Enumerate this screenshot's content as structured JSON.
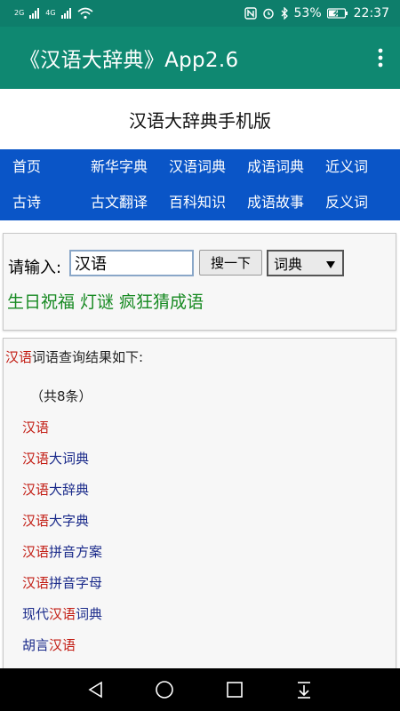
{
  "status_bar": {
    "signal_left": "2G",
    "signal_right": "4G",
    "battery": "53%",
    "time": "22:37"
  },
  "app_bar": {
    "title": "《汉语大辞典》App2.6"
  },
  "site_title": "汉语大辞典手机版",
  "nav": {
    "row1": [
      "首页",
      "新华字典",
      "汉语词典",
      "成语词典",
      "近义词"
    ],
    "row2": [
      "古诗",
      "古文翻译",
      "百科知识",
      "成语故事",
      "反义词"
    ]
  },
  "search": {
    "label": "请输入:",
    "value": "汉语",
    "button": "搜一下",
    "select_value": "词典"
  },
  "links": [
    "生日祝福",
    "灯谜",
    "疯狂猜成语"
  ],
  "results": {
    "heading_keyword": "汉语",
    "heading_rest": "词语查询结果如下:",
    "count": "（共8条）",
    "items": [
      {
        "pre": "",
        "hl": "汉语",
        "post": ""
      },
      {
        "pre": "",
        "hl": "汉语",
        "post": "大词典"
      },
      {
        "pre": "",
        "hl": "汉语",
        "post": "大辞典"
      },
      {
        "pre": "",
        "hl": "汉语",
        "post": "大字典"
      },
      {
        "pre": "",
        "hl": "汉语",
        "post": "拼音方案"
      },
      {
        "pre": "",
        "hl": "汉语",
        "post": "拼音字母"
      },
      {
        "pre": "现代",
        "hl": "汉语",
        "post": "词典"
      },
      {
        "pre": "胡言",
        "hl": "汉语",
        "post": ""
      }
    ]
  },
  "colors": {
    "app_bar": "#0f8871",
    "nav": "#0a55c7",
    "highlight": "#c21b12",
    "link_green": "#178a22"
  }
}
